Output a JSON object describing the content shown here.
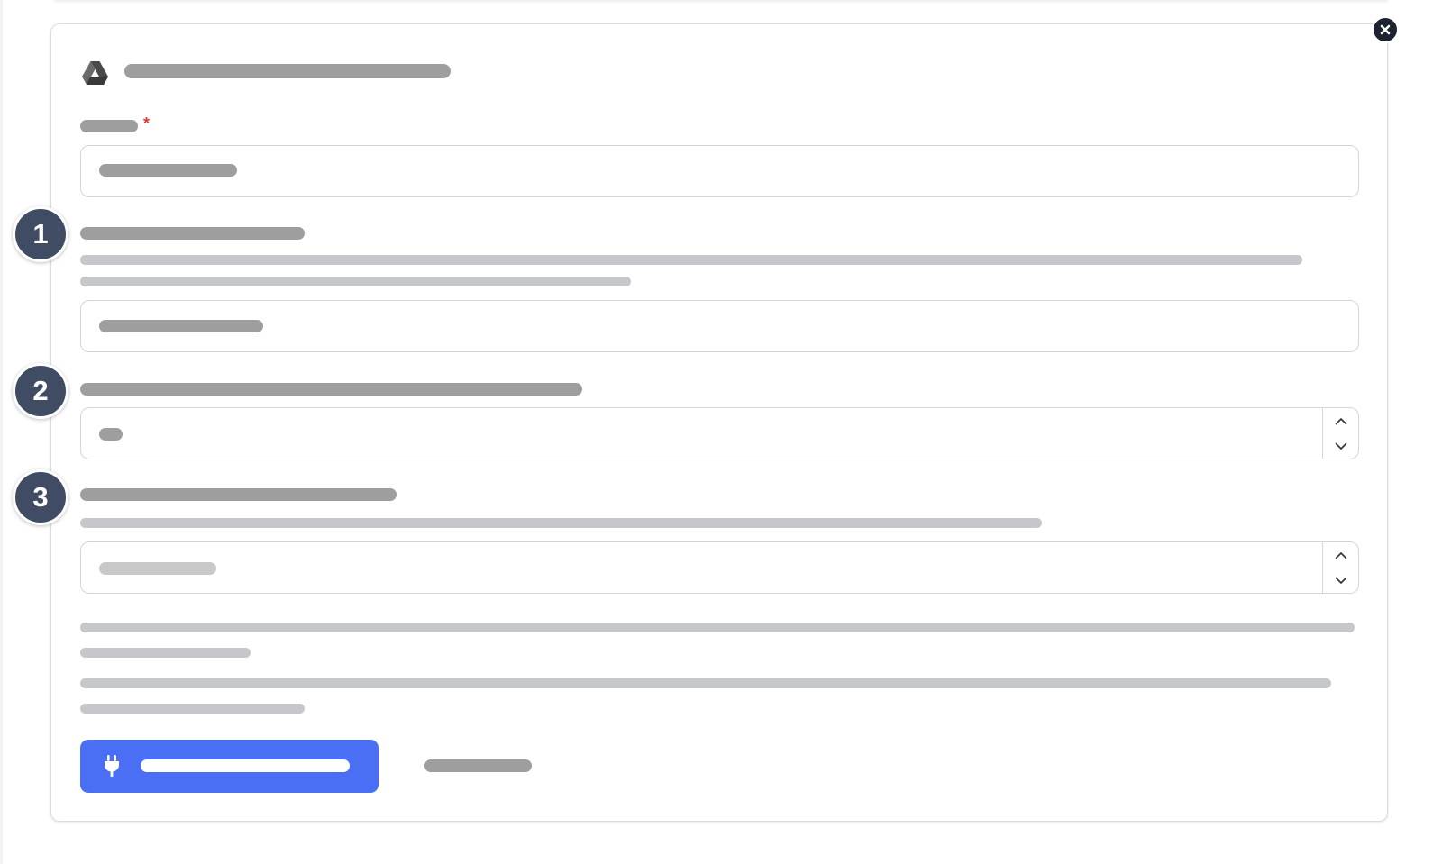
{
  "dialog": {
    "title": "",
    "close_icon": "close-icon",
    "header_icon": "google-drive-icon"
  },
  "fields": [
    {
      "step": "",
      "required": true,
      "required_marker": "*"
    },
    {
      "step": "1"
    },
    {
      "step": "2",
      "control": "number-stepper"
    },
    {
      "step": "3",
      "control": "number-stepper"
    }
  ],
  "actions": {
    "connect_icon": "plug-icon"
  },
  "colors": {
    "accent": "#4a6ff5",
    "badge": "#3f4c63",
    "required": "#e53935",
    "close": "#1d2430"
  }
}
